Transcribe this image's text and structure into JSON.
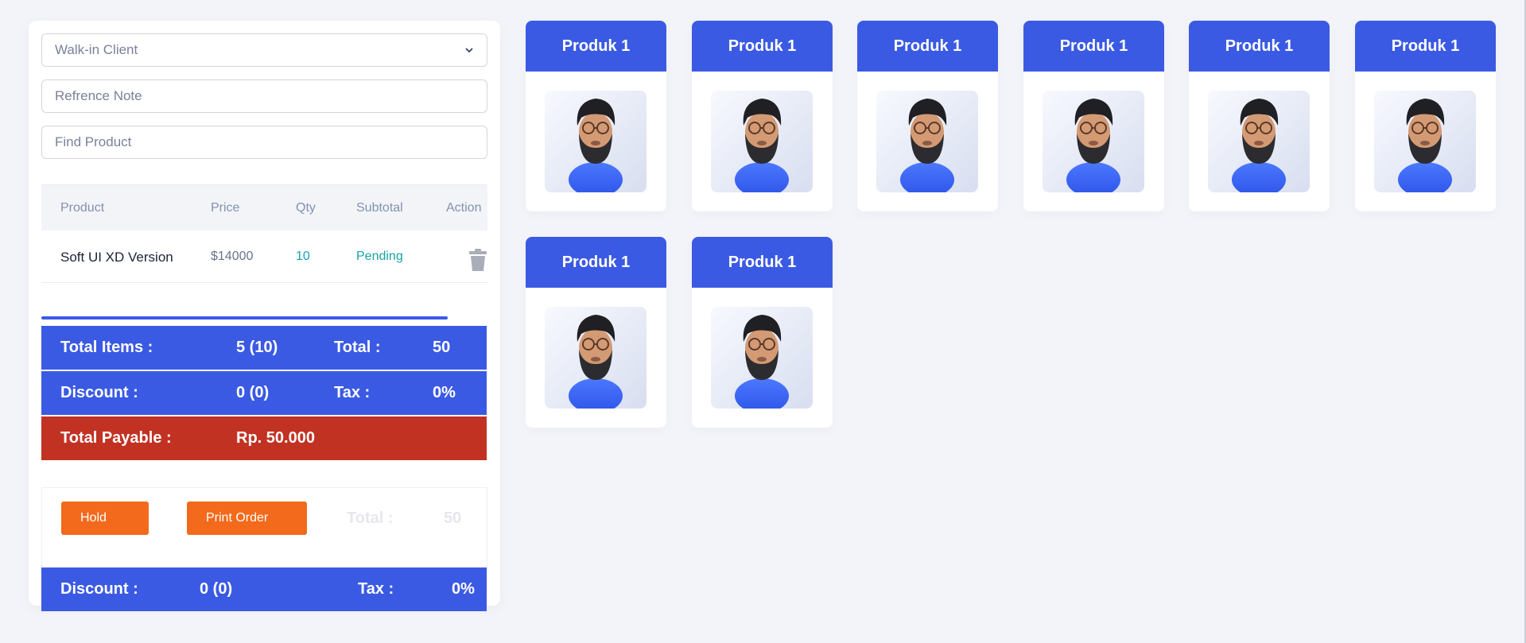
{
  "form": {
    "client_select": "Walk-in Client",
    "reference_placeholder": "Refrence Note",
    "find_placeholder": "Find Product"
  },
  "table": {
    "headers": [
      "Product",
      "Price",
      "Qty",
      "Subtotal",
      "Action"
    ],
    "rows": [
      {
        "product": "Soft UI XD Version",
        "price": "$14000",
        "qty": "10",
        "subtotal": "Pending"
      }
    ]
  },
  "summary": {
    "total_items_label": "Total Items :",
    "total_items_value": "5 (10)",
    "total_label": "Total :",
    "total_value": "50",
    "discount_label": "Discount :",
    "discount_value": "0 (0)",
    "tax_label": "Tax :",
    "tax_value": "0%",
    "payable_label": "Total Payable :",
    "payable_value": "Rp. 50.000"
  },
  "actions": {
    "hold_label": "Hold",
    "print_label": "Print Order",
    "total_label": "Total :",
    "total_value": "50",
    "discount_label": "Discount :",
    "discount_value": "0 (0)",
    "tax_label": "Tax :",
    "tax_value": "0%"
  },
  "products": [
    {
      "title": "Produk 1",
      "image": "bearded-man-avatar"
    },
    {
      "title": "Produk 1",
      "image": "bearded-man-avatar"
    },
    {
      "title": "Produk 1",
      "image": "bearded-man-avatar"
    },
    {
      "title": "Produk 1",
      "image": "bearded-man-avatar"
    },
    {
      "title": "Produk 1",
      "image": "bearded-man-avatar"
    },
    {
      "title": "Produk 1",
      "image": "bearded-man-avatar"
    },
    {
      "title": "Produk 1",
      "image": "bearded-man-avatar"
    },
    {
      "title": "Produk 1",
      "image": "bearded-man-avatar"
    }
  ],
  "colors": {
    "primary": "#3b5ae3",
    "danger": "#c23223",
    "warning": "#f36a1c",
    "info": "#17a2b8"
  }
}
